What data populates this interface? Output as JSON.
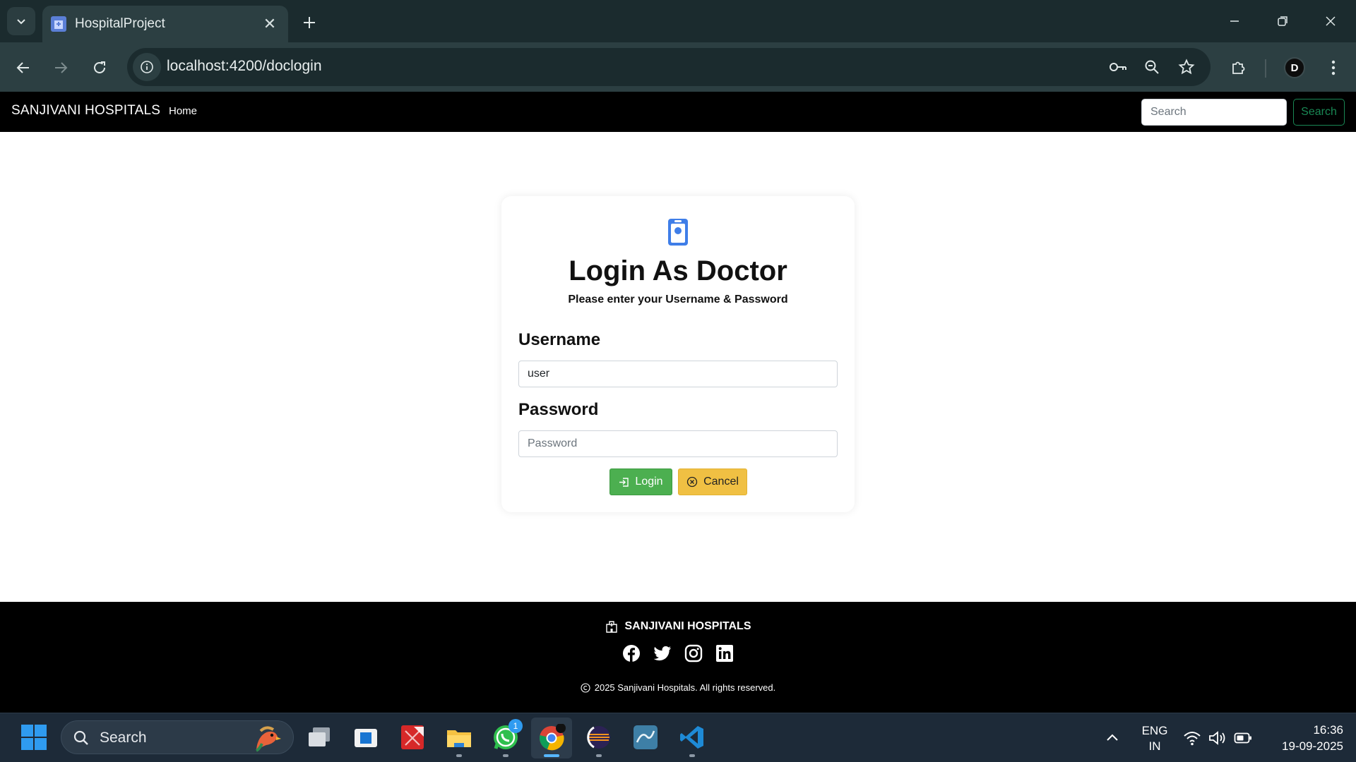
{
  "browser": {
    "tab_title": "HospitalProject",
    "url": "localhost:4200/doclogin"
  },
  "navbar": {
    "brand": "SANJIVANI HOSPITALS",
    "home_label": "Home",
    "search_placeholder": "Search",
    "search_button": "Search"
  },
  "login": {
    "title": "Login As Doctor",
    "subtitle": "Please enter your Username & Password",
    "username_label": "Username",
    "username_value": "user",
    "password_label": "Password",
    "password_placeholder": "Password",
    "login_button": "Login",
    "cancel_button": "Cancel"
  },
  "footer": {
    "brand": "SANJIVANI HOSPITALS",
    "copyright": "2025 Sanjivani Hospitals. All rights reserved.",
    "socials": [
      "facebook-icon",
      "twitter-icon",
      "instagram-icon",
      "linkedin-icon"
    ]
  },
  "taskbar": {
    "search_label": "Search",
    "whatsapp_badge": "1",
    "lang_line1": "ENG",
    "lang_line2": "IN",
    "time": "16:36",
    "date": "19-09-2025"
  },
  "colors": {
    "navbar_bg": "#000000",
    "success": "#198754",
    "login_button": "#4caf50",
    "cancel_button": "#f0c043",
    "card_icon": "#3f7ee8",
    "chrome_dark": "#1b2b2e",
    "chrome_toolbar": "#2c3f42",
    "taskbar": "#1d2a38"
  }
}
